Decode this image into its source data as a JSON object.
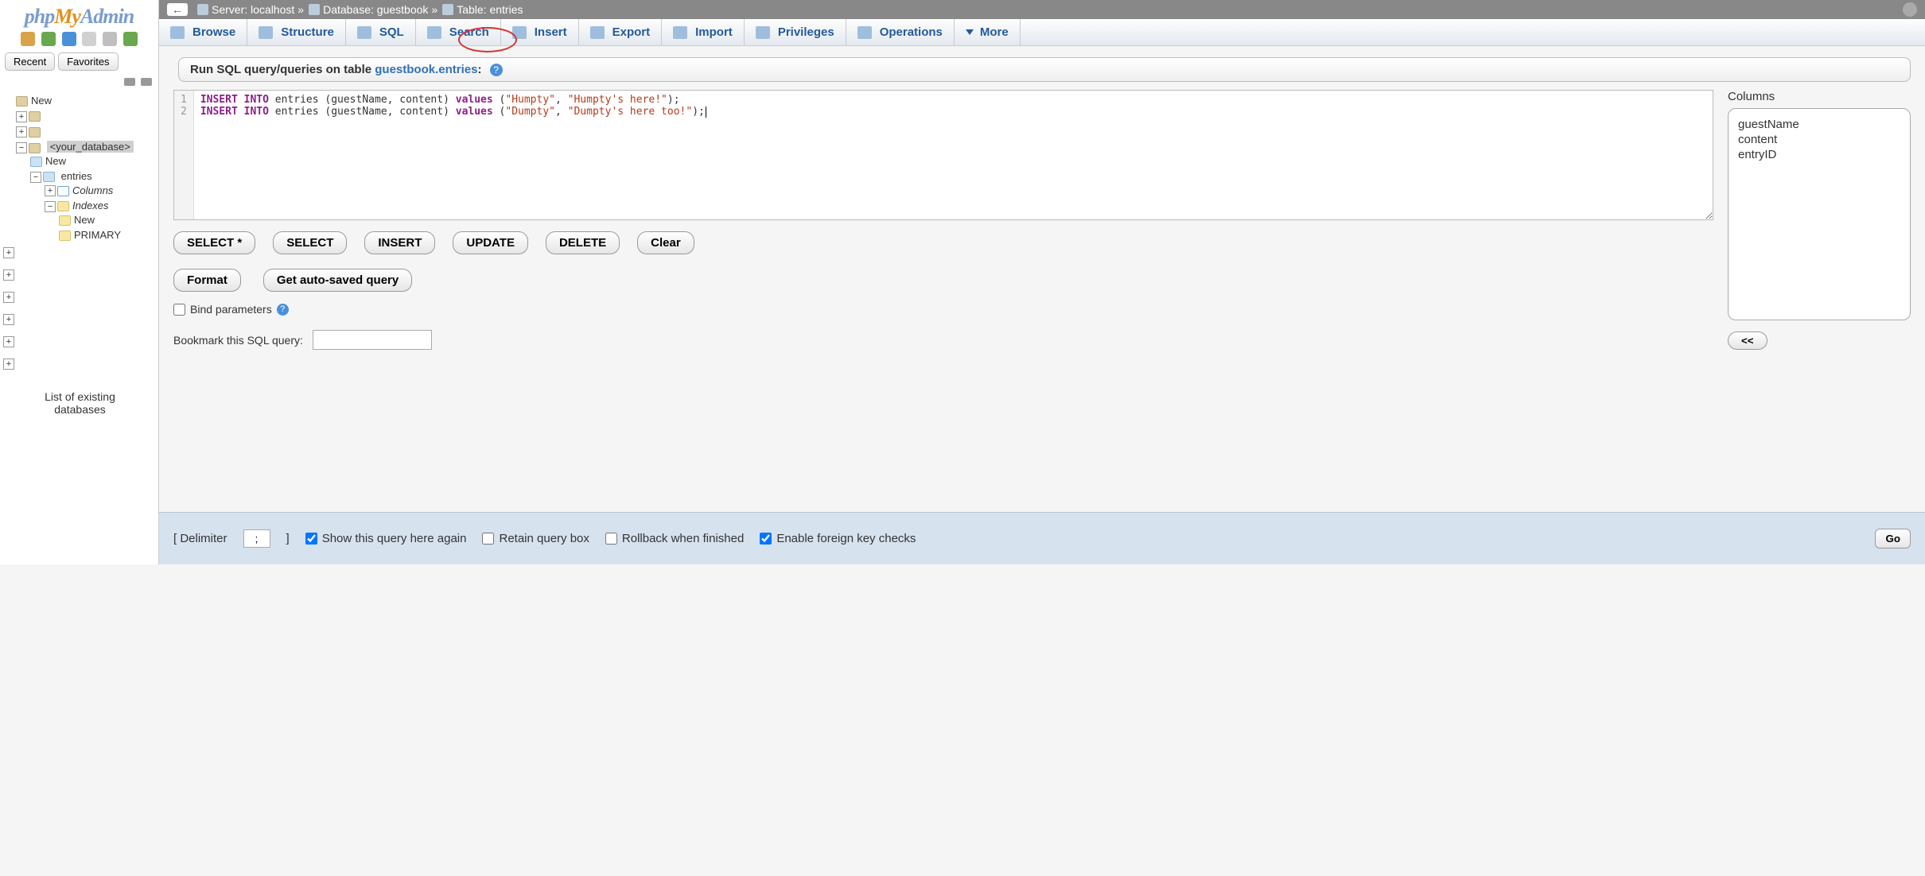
{
  "logo": {
    "php": "php",
    "my": "My",
    "admin": "Admin"
  },
  "panelTabs": {
    "recent": "Recent",
    "favorites": "Favorites"
  },
  "tree": {
    "new": "New",
    "yourDb": "<your_database>",
    "dbNew": "New",
    "entries": "entries",
    "columns": "Columns",
    "indexes": "Indexes",
    "idxNew": "New",
    "primary": "PRIMARY",
    "note1": "List of existing",
    "note2": "databases"
  },
  "breadcrumb": {
    "serverLabel": "Server:",
    "server": "localhost",
    "dbLabel": "Database:",
    "db": "guestbook",
    "tableLabel": "Table:",
    "table": "entries"
  },
  "tabs": {
    "browse": "Browse",
    "structure": "Structure",
    "sql": "SQL",
    "search": "Search",
    "insert": "Insert",
    "export": "Export",
    "import": "Import",
    "privileges": "Privileges",
    "operations": "Operations",
    "more": "More"
  },
  "fieldset": {
    "pre": "Run SQL query/queries on table ",
    "link": "guestbook.entries",
    "colon": ":"
  },
  "code": {
    "l1": {
      "kw1": "INSERT",
      "kw2": "INTO",
      "mid": " entries (guestName, content) ",
      "kw3": "values",
      "paren": " (",
      "s1": "\"Humpty\"",
      "comma": ", ",
      "s2": "\"Humpty's here!\"",
      "end": ");"
    },
    "l2": {
      "kw1": "INSERT",
      "kw2": "INTO",
      "mid": " entries (guestName, content) ",
      "kw3": "values",
      "paren": " (",
      "s1": "\"Dumpty\"",
      "comma": ", ",
      "s2": "\"Dumpty's here too!\"",
      "end": ");"
    },
    "g1": "1",
    "g2": "2"
  },
  "buttons": {
    "selectAll": "SELECT *",
    "select": "SELECT",
    "insert": "INSERT",
    "update": "UPDATE",
    "delete": "DELETE",
    "clear": "Clear",
    "format": "Format",
    "getAuto": "Get auto-saved query",
    "colsArrow": "<<",
    "go": "Go"
  },
  "bind": {
    "label": "Bind parameters"
  },
  "bookmark": {
    "label": "Bookmark this SQL query:"
  },
  "columns": {
    "header": "Columns",
    "c1": "guestName",
    "c2": "content",
    "c3": "entryID"
  },
  "bottom": {
    "delimLabel": "Delimiter",
    "delim": ";",
    "showAgain": "Show this query here again",
    "retain": "Retain query box",
    "rollback": "Rollback when finished",
    "fk": "Enable foreign key checks"
  }
}
